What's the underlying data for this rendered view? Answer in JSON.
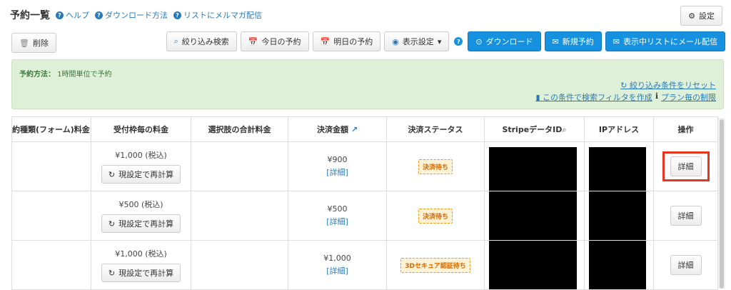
{
  "header": {
    "title": "予約一覧",
    "links": [
      "ヘルプ",
      "ダウンロード方法",
      "リストにメルマガ配信"
    ],
    "settings_label": "設定"
  },
  "toolbar": {
    "delete_label": "削除",
    "filter_search": "絞り込み検索",
    "today": "今日の予約",
    "tomorrow": "明日の予約",
    "display_settings": "表示設定",
    "download": "ダウンロード",
    "new_reservation": "新規予約",
    "mail_list": "表示中リストにメール配信"
  },
  "info": {
    "method_label": "予約方法：",
    "method_value": "1時間単位で予約",
    "reset_link": "絞り込み条件をリセット",
    "create_filter": "この条件で検索フィルタを作成",
    "plan_limit": "プラン毎の制限"
  },
  "table": {
    "headers": [
      "約種類(フォーム)料金",
      "受付枠毎の料金",
      "選択肢の合計料金",
      "決済金額",
      "決済ステータス",
      "StripeデータID",
      "IPアドレス",
      "操作"
    ],
    "rows": [
      {
        "slot_price": "¥1,000 (税込)",
        "recalc": "現設定で再計算",
        "amount": "¥900",
        "detail_link": "[詳細]",
        "status": "決済待ち",
        "action": "詳細"
      },
      {
        "slot_price": "¥500 (税込)",
        "recalc": "現設定で再計算",
        "amount": "¥500",
        "detail_link": "[詳細]",
        "status": "決済待ち",
        "action": "詳細"
      },
      {
        "slot_price": "¥1,000 (税込)",
        "recalc": "現設定で再計算",
        "amount": "¥1,000",
        "detail_link": "[詳細]",
        "status": "3Dセキュア認証待ち",
        "action": "詳細"
      }
    ]
  },
  "colors": {
    "primary": "#1591e0",
    "link": "#2a7ab8",
    "info_bg": "#dff0d8",
    "badge_border": "#e89a1a",
    "highlight": "#e8351e"
  }
}
